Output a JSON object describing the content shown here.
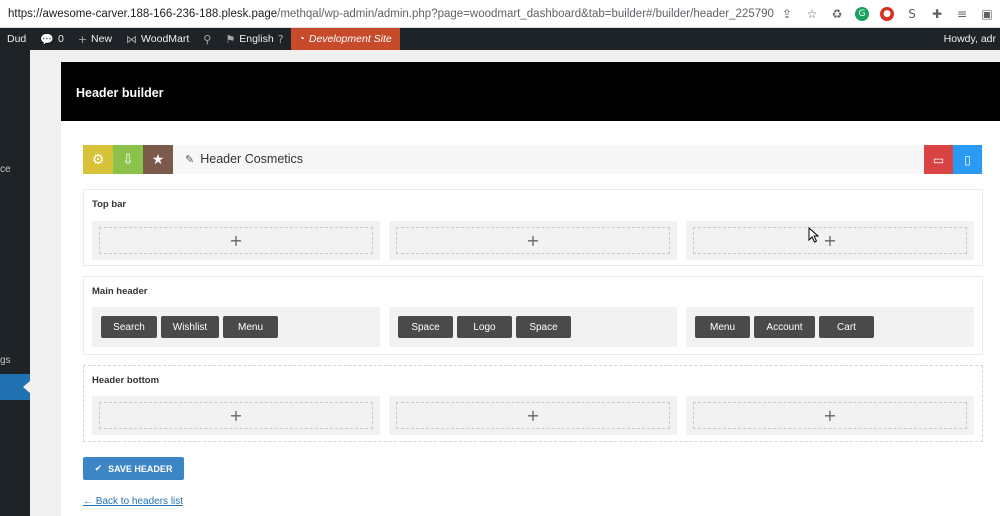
{
  "browser": {
    "url_host": "https://awesome-carver.188-166-236-188.plesk.page",
    "url_path": "/methqal/wp-admin/admin.php?page=woodmart_dashboard&tab=builder#/builder/header_225790",
    "icons": [
      "share-icon",
      "star-icon",
      "recycle-icon",
      "grammarly-icon",
      "adblock-icon",
      "s-icon",
      "puzzle-icon",
      "playlist-icon",
      "sidepanel-icon"
    ]
  },
  "wp_admin_bar": {
    "site_fragment": "Dud",
    "comments_count": "0",
    "new_label": "New",
    "woodmart_label": "WoodMart",
    "language_label": "English",
    "dev_site_label": "Development Site",
    "howdy": "Howdy, adr"
  },
  "sidebar": {
    "fragment_1": "ce",
    "fragment_2": "gs"
  },
  "panel": {
    "title": "Header builder"
  },
  "toolbar": {
    "header_name": "Header Cosmetics",
    "colors": {
      "settings": "#d8c23a",
      "import": "#8bc34a",
      "favorite": "#7b5a4c",
      "desktop": "#d94343",
      "mobile": "#2b9af3"
    }
  },
  "sections": {
    "top_bar": {
      "title": "Top bar",
      "add_symbol": "+"
    },
    "main_header": {
      "title": "Main header",
      "left": [
        "Search",
        "Wishlist",
        "Menu"
      ],
      "center": [
        "Space",
        "Logo",
        "Space"
      ],
      "right": [
        "Menu",
        "Account",
        "Cart"
      ]
    },
    "header_bottom": {
      "title": "Header bottom",
      "add_symbol": "+"
    }
  },
  "actions": {
    "save_label": "SAVE HEADER",
    "back_label": "← Back to headers list"
  }
}
